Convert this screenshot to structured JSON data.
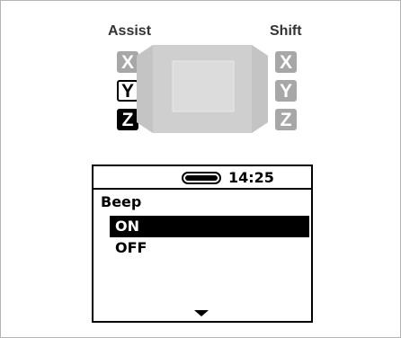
{
  "labels": {
    "assist": "Assist",
    "shift": "Shift"
  },
  "assist_keys": [
    {
      "letter": "X",
      "state": "inactive"
    },
    {
      "letter": "Y",
      "state": "outlined"
    },
    {
      "letter": "Z",
      "state": "active"
    }
  ],
  "shift_keys": [
    {
      "letter": "X",
      "state": "inactive"
    },
    {
      "letter": "Y",
      "state": "inactive"
    },
    {
      "letter": "Z",
      "state": "inactive"
    }
  ],
  "display": {
    "battery_level": 1.0,
    "time": "14:25",
    "menu_title": "Beep",
    "options": [
      {
        "label": "ON",
        "selected": true
      },
      {
        "label": "OFF",
        "selected": false
      }
    ],
    "scroll_icon": "triangle-down-icon"
  },
  "colors": {
    "inactive_key": "#a7a7a7",
    "device_body": "#cfcfcf",
    "device_screen": "#dcdcdc"
  }
}
